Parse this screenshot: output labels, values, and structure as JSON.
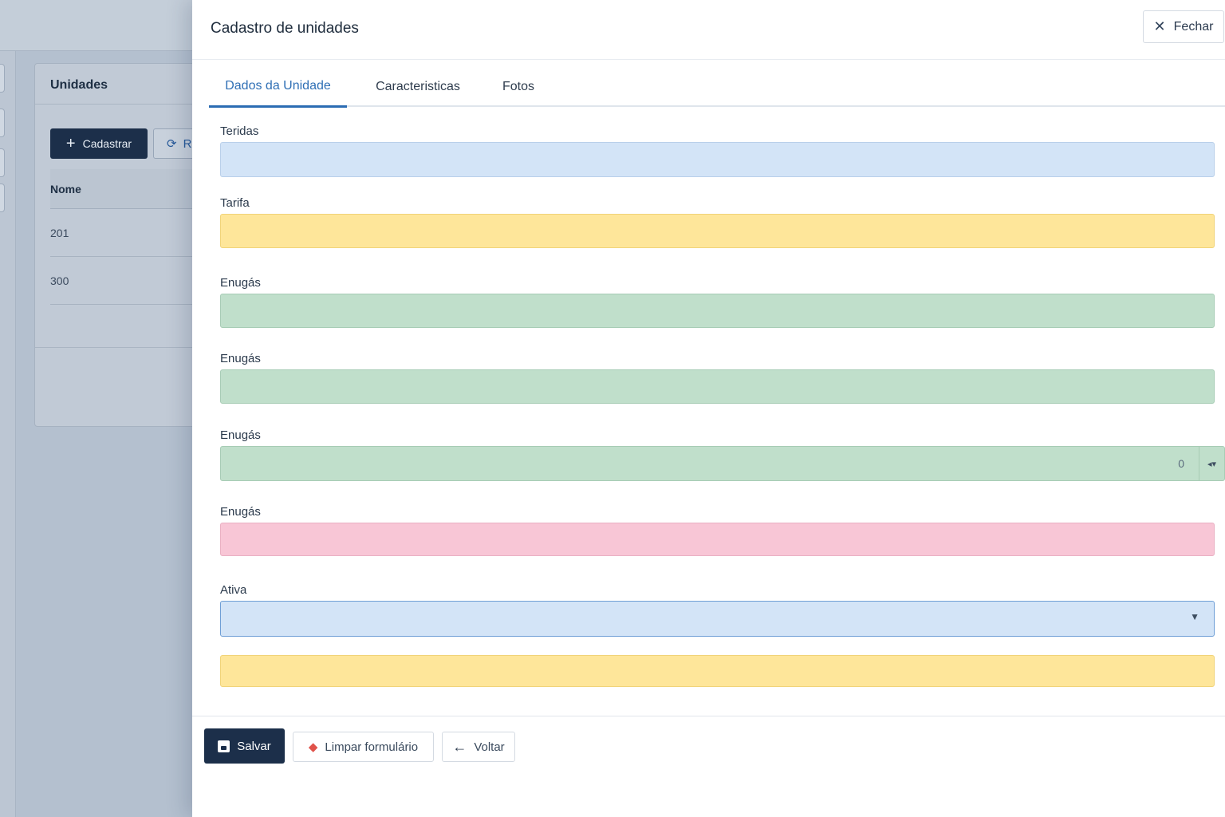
{
  "background": {
    "card_title": "Unidades",
    "add_button": "Cadastrar",
    "refresh_button_partial": "R",
    "table_header": "Nome",
    "rows": [
      "201",
      "300"
    ]
  },
  "drawer": {
    "title": "Cadastro de unidades",
    "close_label": "Fechar",
    "tabs": [
      "Dados da Unidade",
      "Caracteristicas",
      "Fotos"
    ],
    "fields": [
      {
        "label": "Teridas",
        "color": "#d3e4f7"
      },
      {
        "label": "Tarifa",
        "color": "#fee69a"
      },
      {
        "label": "Enugás",
        "color": "#c0dfcb"
      },
      {
        "label": "Enugás",
        "color": "#c0dfcb"
      },
      {
        "label": "Enugás",
        "color": "#c0dfcb",
        "value": "0"
      },
      {
        "label": "Enugás",
        "color": "#f8c6d6"
      },
      {
        "label": "Ativa",
        "color": "#d3e4f7"
      },
      {
        "label": "",
        "color": "#fee69a"
      }
    ],
    "footer": {
      "save_label": "Salvar",
      "clear_label": "Limpar formulário",
      "back_label": "Voltar"
    }
  }
}
